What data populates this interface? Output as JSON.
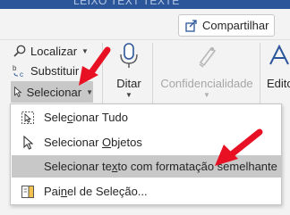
{
  "titlebar": {
    "text": "LEIXO TEXT TEXTE"
  },
  "share": {
    "label": "Compartilhar"
  },
  "editing": {
    "find": {
      "label": "Localizar"
    },
    "replace": {
      "label": "Substituir"
    },
    "select": {
      "label": "Selecionar"
    }
  },
  "ribbon": {
    "dictate": {
      "label": "Ditar"
    },
    "sensitivity": {
      "label": "Confidencialidade"
    },
    "editor": {
      "label": "Edito"
    }
  },
  "menu": {
    "items": [
      {
        "pre": "Sele",
        "accel": "c",
        "post": "ionar Tudo"
      },
      {
        "pre": "Selecionar ",
        "accel": "O",
        "post": "bjetos"
      },
      {
        "pre": "Selecionar te",
        "accel": "x",
        "post": "to com formatação semelhante"
      },
      {
        "pre": "Pai",
        "accel": "n",
        "post": "el de Seleção..."
      }
    ]
  },
  "colors": {
    "accent": "#2b579a",
    "highlight": "#c8c8c8",
    "annotation_arrow": "#e81123"
  }
}
